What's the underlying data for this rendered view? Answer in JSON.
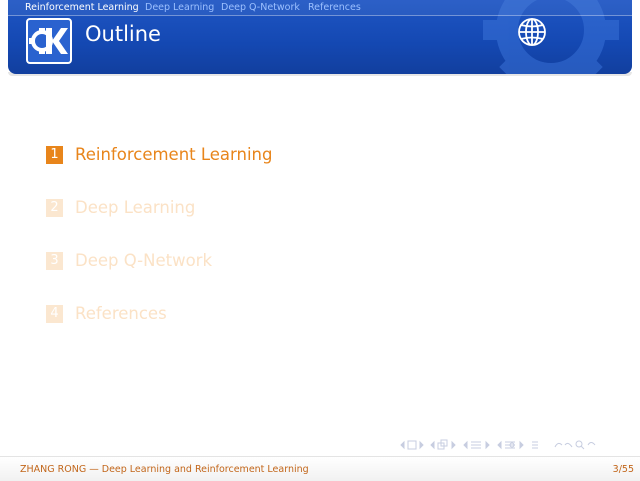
{
  "header": {
    "nav": [
      {
        "label": "Reinforcement Learning",
        "active": true
      },
      {
        "label": "Deep Learning",
        "active": false
      },
      {
        "label": "Deep Q-Network",
        "active": false
      },
      {
        "label": "References",
        "active": false
      }
    ],
    "title": "Outline",
    "logo_icon": "kde-logo-icon",
    "globe_icon": "globe-icon"
  },
  "toc": [
    {
      "number": "1",
      "label": "Reinforcement Learning",
      "highlighted": true
    },
    {
      "number": "2",
      "label": "Deep Learning",
      "highlighted": false
    },
    {
      "number": "3",
      "label": "Deep Q-Network",
      "highlighted": false
    },
    {
      "number": "4",
      "label": "References",
      "highlighted": false
    }
  ],
  "footer": {
    "author": "ZHANG RONG",
    "separator": "—",
    "talk_title": "Deep Learning and Reinforcement Learning",
    "page": "3/55"
  },
  "colors": {
    "header_blue": "#1448b2",
    "accent_orange": "#e8851b",
    "dim_orange": "#fbe2c6",
    "footer_text": "#c2661a"
  }
}
